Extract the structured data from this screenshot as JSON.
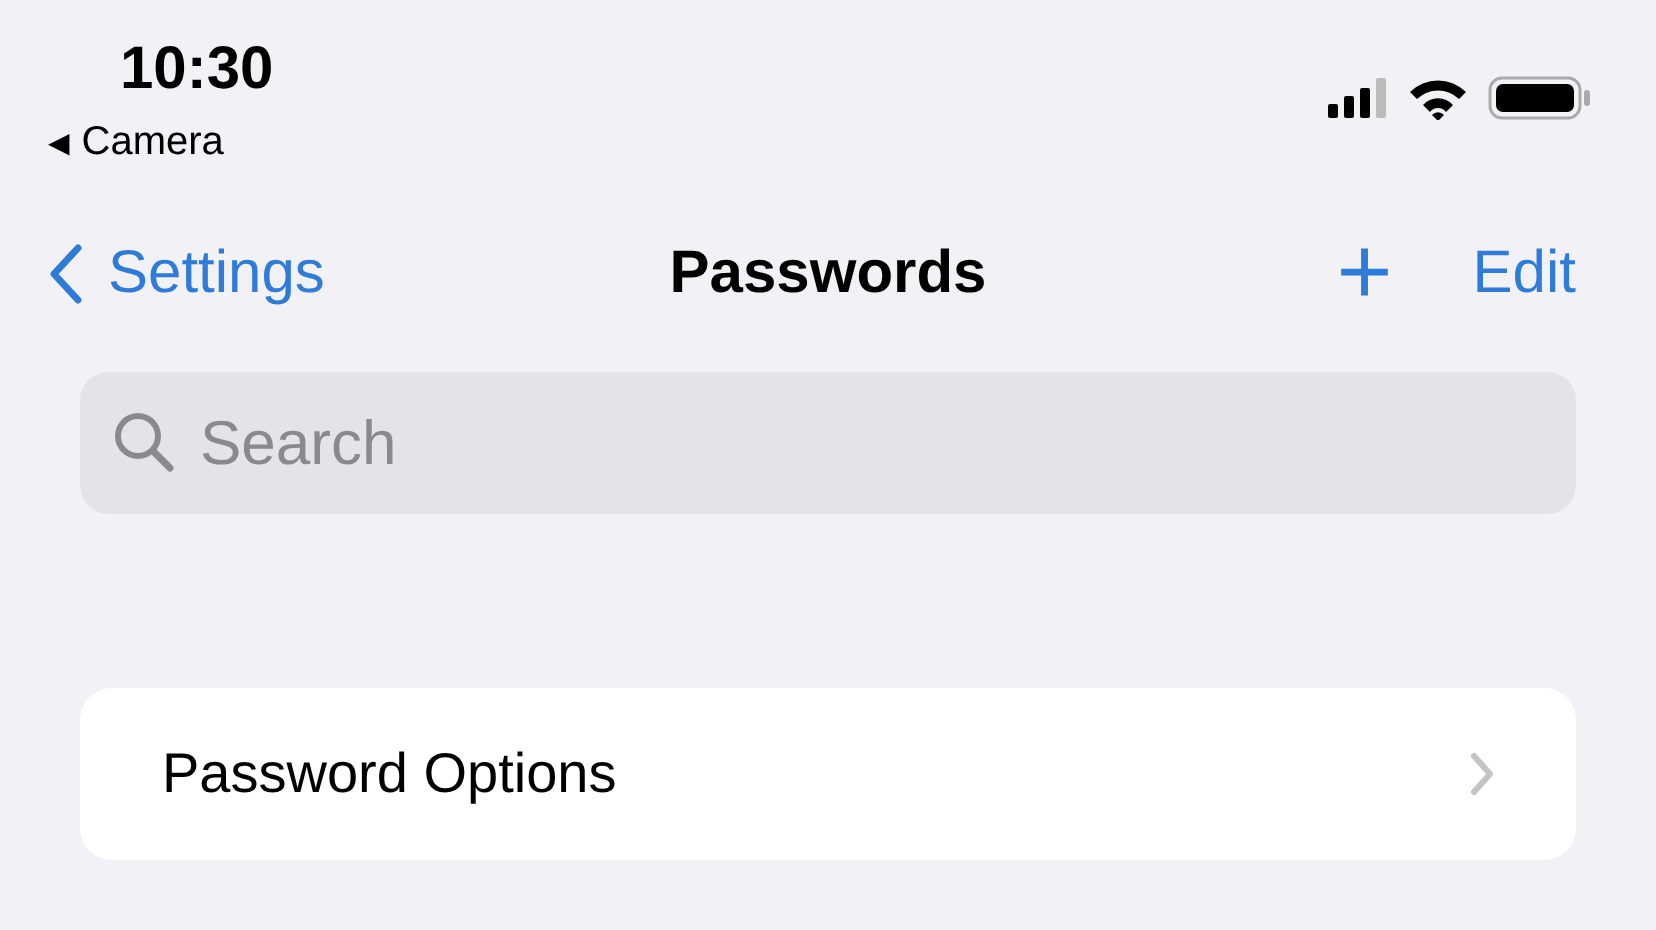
{
  "status_bar": {
    "time": "10:30",
    "back_arrow": "◀",
    "back_app": "Camera"
  },
  "nav": {
    "back": "Settings",
    "title": "Passwords",
    "add": "+",
    "edit": "Edit"
  },
  "search": {
    "placeholder": "Search"
  },
  "rows": [
    {
      "label": "Password Options"
    }
  ]
}
